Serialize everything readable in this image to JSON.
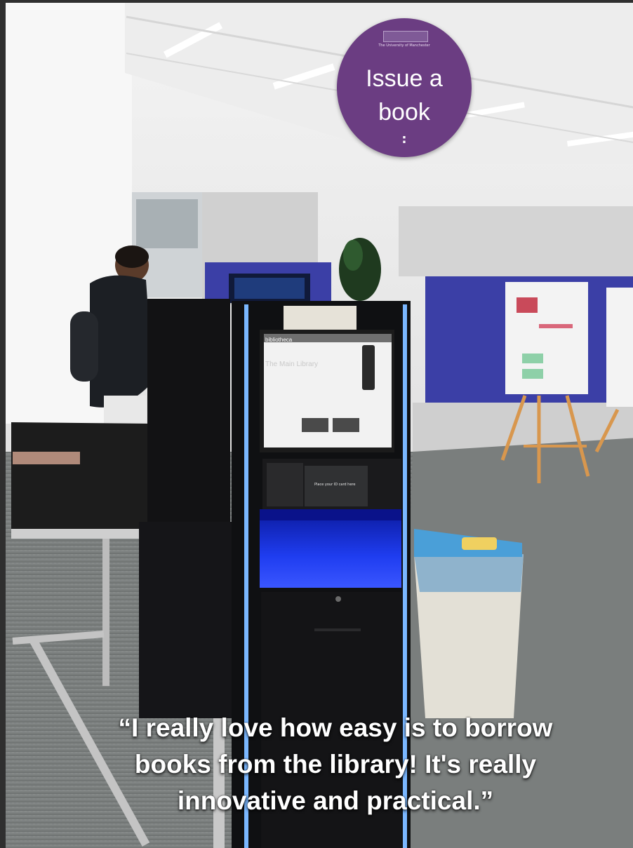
{
  "sign": {
    "brand": "",
    "subtitle": "The University of Manchester",
    "text": "Issue a\nbook",
    "dots": ":"
  },
  "kiosk": {
    "brand": "bibliotheca",
    "screen_title": "The Main Library",
    "card_slot_note": "Place your ID card here"
  },
  "quote": {
    "text": "“I really love how easy is to borrow\nbooks from the library! It's really\ninnovative and practical.”"
  },
  "colors": {
    "sign": "#6b3d82",
    "wall_panel": "#3b3fa6",
    "kiosk_glow": "#2a4cff",
    "bin": "#4a9fd8"
  }
}
